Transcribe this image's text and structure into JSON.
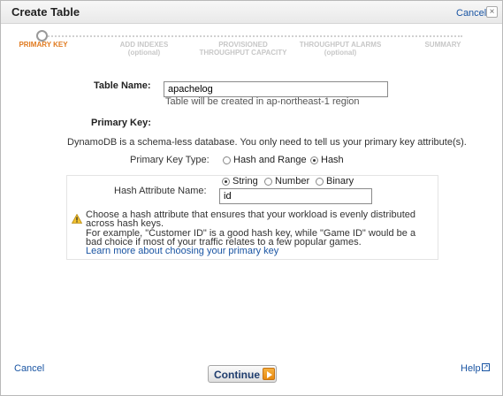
{
  "dialog": {
    "title": "Create Table",
    "cancel_top": "Cancel",
    "close_symbol": "×"
  },
  "steps": [
    {
      "label": "PRIMARY KEY",
      "sub": "",
      "active": true
    },
    {
      "label": "ADD INDEXES",
      "sub": "(optional)",
      "active": false
    },
    {
      "label": "PROVISIONED",
      "sub": "THROUGHPUT CAPACITY",
      "active": false
    },
    {
      "label": "THROUGHPUT ALARMS",
      "sub": "(optional)",
      "active": false
    },
    {
      "label": "SUMMARY",
      "sub": "",
      "active": false
    }
  ],
  "form": {
    "table_name_label": "Table Name:",
    "table_name_value": "apachelog",
    "table_name_hint": "Table will be created in ap-northeast-1 region",
    "primary_key_label": "Primary Key:",
    "schema_text": "DynamoDB is a schema-less database. You only need to tell us your primary key attribute(s).",
    "pk_type_label": "Primary Key Type:",
    "pk_type_options": {
      "hash_and_range": "Hash and Range",
      "hash": "Hash"
    },
    "pk_type_selected": "Hash",
    "hash_attr_label": "Hash Attribute Name:",
    "attr_type_options": {
      "string": "String",
      "number": "Number",
      "binary": "Binary"
    },
    "attr_type_selected": "String",
    "hash_attr_value": "id",
    "warning_line1": "Choose a hash attribute that ensures that your workload is evenly distributed",
    "warning_line2": "across hash keys.",
    "example_line1": "For example, \"Customer ID\" is a good hash key, while \"Game ID\" would be a",
    "example_line2": "bad choice if most of your traffic relates to a few popular games.",
    "learn_more": "Learn more about choosing your primary key"
  },
  "footer": {
    "cancel": "Cancel",
    "continue": "Continue",
    "help": "Help"
  },
  "colors": {
    "link": "#1a55a3",
    "active_step": "#e07a1f",
    "continue_arrow": "#e88a10"
  }
}
